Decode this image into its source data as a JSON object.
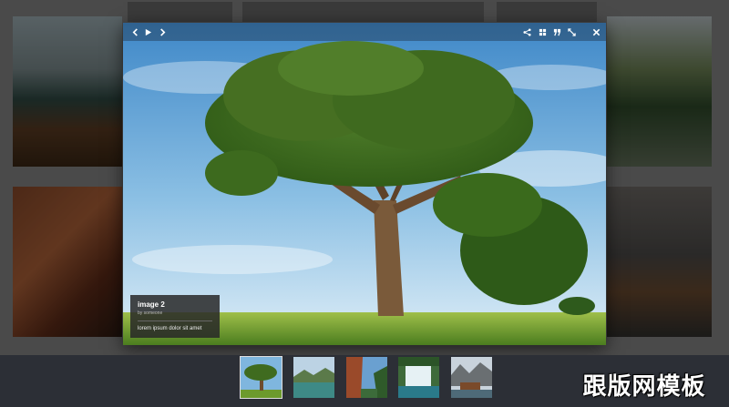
{
  "lightbox": {
    "caption": {
      "title": "image 2",
      "author": "by someone",
      "description": "lorem ipsum dolor sit amet"
    },
    "toolbar": {
      "left": [
        "chevron-left-icon",
        "play-icon",
        "chevron-right-icon"
      ],
      "right": [
        "share-icon",
        "grid-icon",
        "quote-icon",
        "fullscreen-icon",
        "close-icon"
      ]
    }
  },
  "thumbnails": [
    {
      "subject": "tree",
      "active": true
    },
    {
      "subject": "lake"
    },
    {
      "subject": "canyon"
    },
    {
      "subject": "waterfall"
    },
    {
      "subject": "cabin"
    }
  ],
  "watermark": "跟版网模板",
  "colors": {
    "overlay": "#4a4a4a",
    "strip": "#2c2f36",
    "caption_bg": "#282828"
  }
}
